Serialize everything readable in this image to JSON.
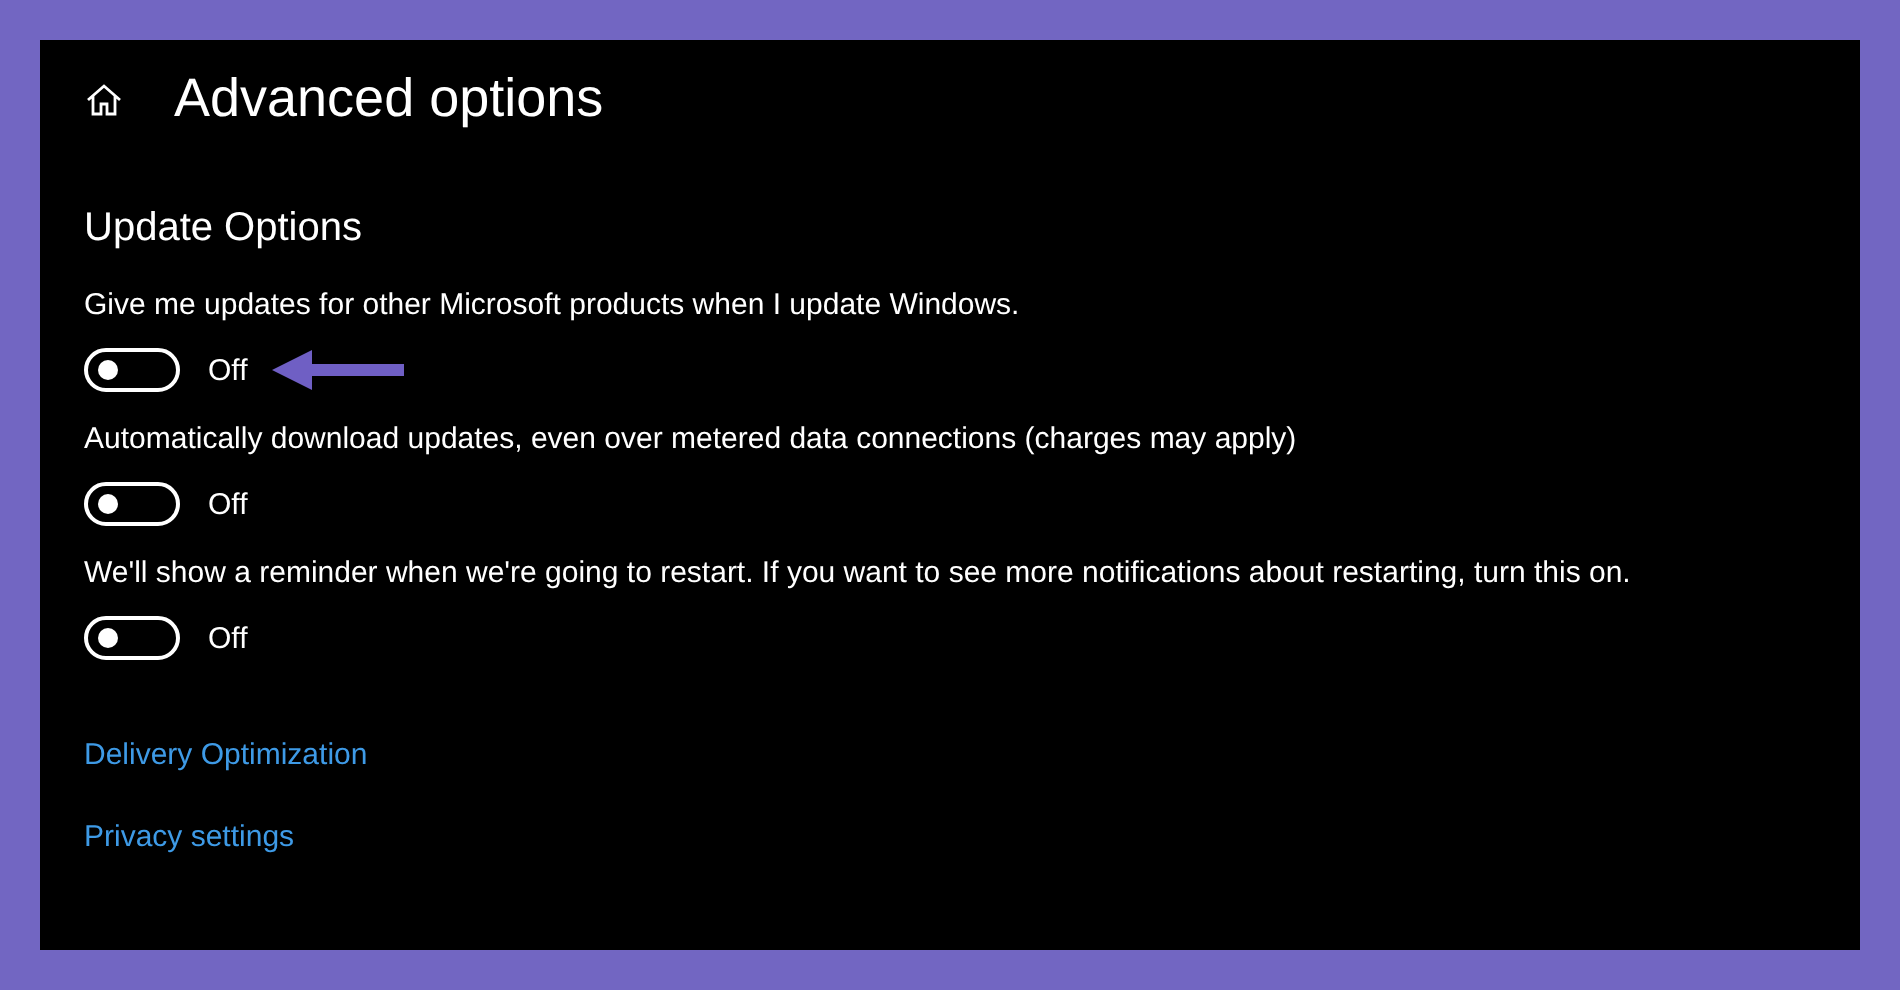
{
  "page": {
    "title": "Advanced options"
  },
  "section": {
    "title": "Update Options"
  },
  "settings": [
    {
      "label": "Give me updates for other Microsoft products when I update Windows.",
      "on": false,
      "state_text": "Off"
    },
    {
      "label": "Automatically download updates, even over metered data connections (charges may apply)",
      "on": false,
      "state_text": "Off"
    },
    {
      "label": "We'll show a reminder when we're going to restart. If you want to see more notifications about restarting, turn this on.",
      "on": false,
      "state_text": "Off"
    }
  ],
  "links": [
    "Delivery Optimization",
    "Privacy settings"
  ]
}
